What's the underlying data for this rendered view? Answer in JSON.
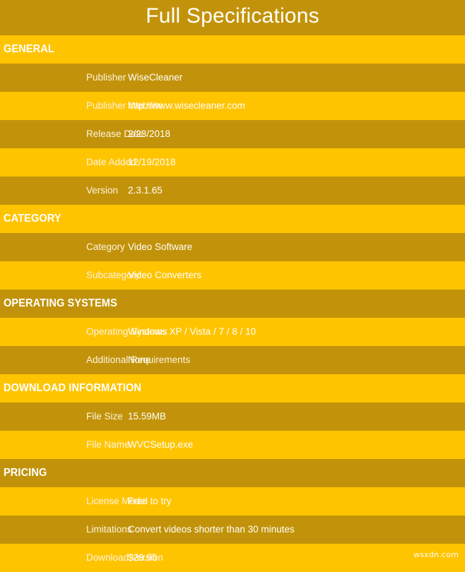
{
  "page": {
    "title": "Full Specifications",
    "watermark": "wsxdn.com",
    "colors": {
      "band_dark": "#c2930a",
      "band_light": "#ffc400",
      "text": "#ffffff",
      "label_text": "#fdf3e0"
    }
  },
  "sections": [
    {
      "heading": "GENERAL",
      "rows": [
        {
          "label": "Publisher",
          "value": "WiseCleaner"
        },
        {
          "label": "Publisher Website",
          "value": "http://www.wisecleaner.com"
        },
        {
          "label": "Release Date",
          "value": "2/23/2018"
        },
        {
          "label": "Date Added",
          "value": "12/19/2018"
        },
        {
          "label": "Version",
          "value": "2.3.1.65"
        }
      ]
    },
    {
      "heading": "CATEGORY",
      "rows": [
        {
          "label": "Category",
          "value": "Video Software"
        },
        {
          "label": "Subcategory",
          "value": "Video Converters"
        }
      ]
    },
    {
      "heading": "OPERATING SYSTEMS",
      "rows": [
        {
          "label": "Operating Systems",
          "value": "Windows XP / Vista / 7 / 8 / 10"
        },
        {
          "label": "Additional Requirements",
          "value": "None"
        }
      ]
    },
    {
      "heading": "DOWNLOAD INFORMATION",
      "rows": [
        {
          "label": "File Size",
          "value": "15.59MB"
        },
        {
          "label": "File Name",
          "value": "WVCSetup.exe"
        }
      ]
    },
    {
      "heading": "PRICING",
      "rows": [
        {
          "label": "License Model",
          "value": "Free to try"
        },
        {
          "label": "Limitations",
          "value": "Convert videos shorter than 30 minutes"
        },
        {
          "label": "Download Version",
          "value": "$29.95"
        }
      ]
    }
  ]
}
